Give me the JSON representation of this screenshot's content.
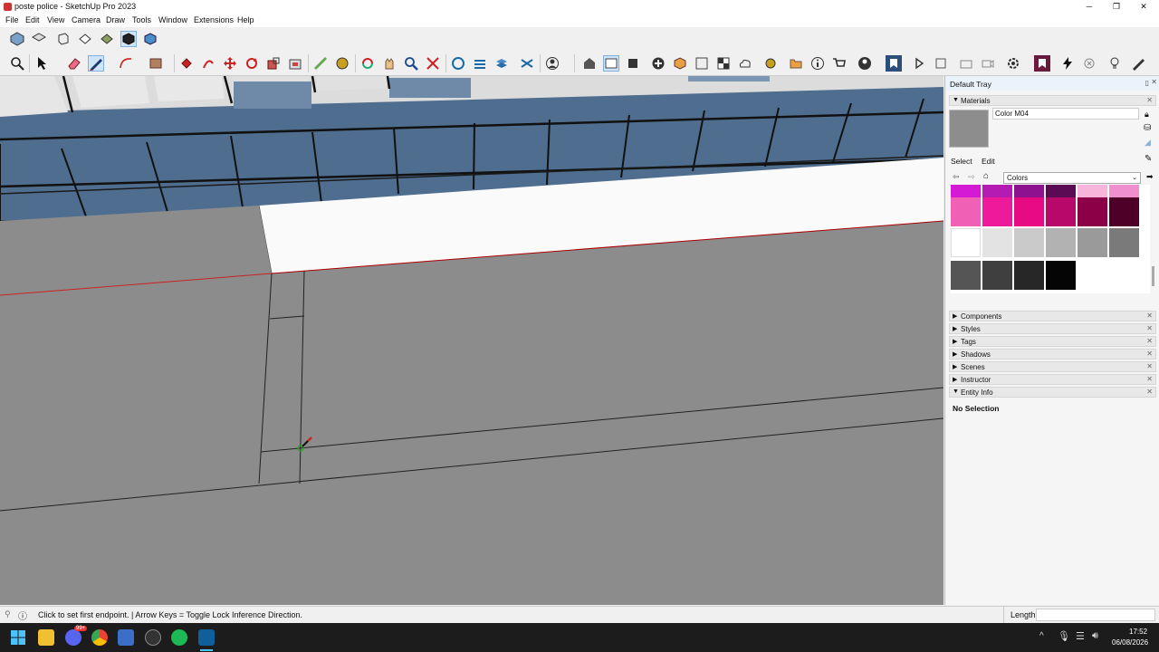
{
  "window": {
    "title": "poste police - SketchUp Pro 2023",
    "minimize": "─",
    "maximize": "❐",
    "close": "✕"
  },
  "menu": [
    "File",
    "Edit",
    "View",
    "Camera",
    "Draw",
    "Tools",
    "Window",
    "Extensions",
    "Help"
  ],
  "tray": {
    "title": "Default Tray",
    "materials": {
      "header": "Materials",
      "current_material": "Color M04",
      "tab_select": "Select",
      "tab_edit": "Edit",
      "collection": "Colors",
      "swatch_colors": [
        [
          "#d51ad6",
          "#b31bb3",
          "#8e1290",
          "#5a0b54",
          "#f8b5dc",
          "#f08fcf"
        ],
        [
          "#f060b4",
          "#ee1a9c",
          "#e80a82",
          "#b8096a",
          "#8c0047",
          "#4f0029"
        ],
        [
          "#ffffff",
          "#e3e3e3",
          "#cacaca",
          "#b2b2b2",
          "#9a9a9a",
          "#7a7a7a"
        ],
        [
          "#555555",
          "#3f3f3f",
          "#272727",
          "#050505"
        ]
      ]
    },
    "panels": [
      "Components",
      "Styles",
      "Tags",
      "Shadows",
      "Scenes",
      "Instructor",
      "Entity Info"
    ],
    "entity_info_text": "No Selection"
  },
  "status": {
    "message": "Click to set first endpoint. | Arrow Keys = Toggle Lock Inference Direction.",
    "measure_label": "Length",
    "measure_value": ""
  },
  "taskbar": {
    "time": "17:52",
    "date": "06/08/2026",
    "discord_badge": "99+"
  }
}
